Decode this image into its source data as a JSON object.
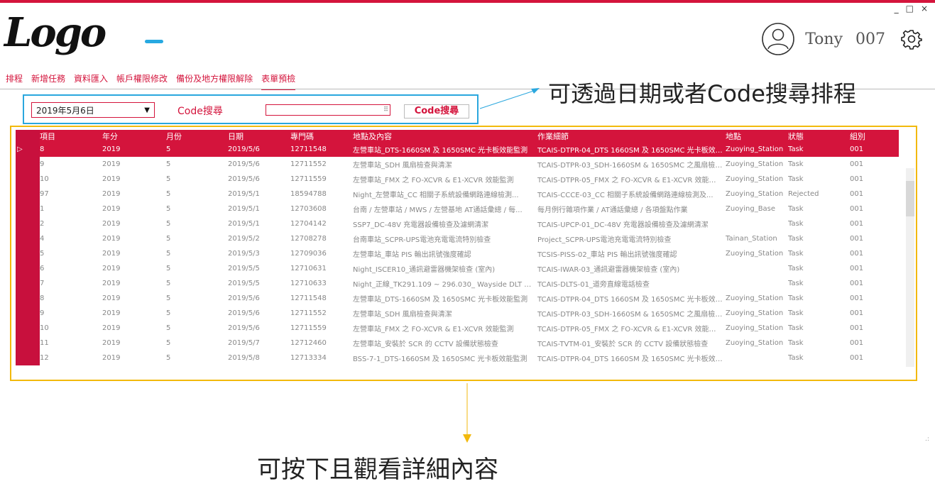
{
  "window": {
    "minimize": "_",
    "maximize": "□",
    "close": "×"
  },
  "brand": {
    "logo_text": "Logo"
  },
  "user": {
    "name": "Tony",
    "id": "007"
  },
  "nav": {
    "items": [
      "排程",
      "新增任務",
      "資料匯入",
      "帳戶權限修改",
      "備份及地方權限解除",
      "表單預檢"
    ],
    "active_index": 5
  },
  "search": {
    "date_value": "2019年5月6日",
    "code_label": "Code搜尋",
    "code_value": "",
    "input_icon": "⠿",
    "button_label": "Code搜尋"
  },
  "annotations": {
    "search_hint": "可透過日期或者Code搜尋排程",
    "detail_hint": "可按下且觀看詳細內容"
  },
  "table": {
    "columns": [
      "項目",
      "年分",
      "月份",
      "日期",
      "專門碼",
      "地點及內容",
      "作業細節",
      "地點",
      "狀態",
      "組別"
    ],
    "selected_marker": "▷",
    "selected_index": 0,
    "rows": [
      [
        "8",
        "2019",
        "5",
        "2019/5/6",
        "12711548",
        "左營車站_DTS-1660SM 及 1650SMC 光卡板效能監測",
        "TCAIS-DTPR-04_DTS 1660SM 及 1650SMC 光卡板效能...",
        "Zuoying_Station",
        "Task",
        "001"
      ],
      [
        "9",
        "2019",
        "5",
        "2019/5/6",
        "12711552",
        "左營車站_SDH 風扇檢查與清潔",
        "TCAIS-DTPR-03_SDH-1660SM & 1650SMC 之風扇檢查...",
        "Zuoying_Station",
        "Task",
        "001"
      ],
      [
        "10",
        "2019",
        "5",
        "2019/5/6",
        "12711559",
        "左營車站_FMX 之 FO-XCVR & E1-XCVR 效能監測",
        "TCAIS-DTPR-05_FMX 之 FO-XCVR & E1-XCVR 效能監測",
        "Zuoying_Station",
        "Task",
        "001"
      ],
      [
        "97",
        "2019",
        "5",
        "2019/5/1",
        "18594788",
        "Night_左營車站_CC 相關子系統設備網路連線檢測...",
        "TCAIS-CCCE-03_CC 相關子系統設備網路連線檢測及...",
        "Zuoying_Station",
        "Rejected",
        "001"
      ],
      [
        "1",
        "2019",
        "5",
        "2019/5/1",
        "12703608",
        "台南 / 左營車站 / MWS / 左營基地 AT通話彙總 / 每...",
        "每月例行雜項作業 / AT通話彙總 / 各項盤點作業",
        "Zuoying_Base",
        "Task",
        "001"
      ],
      [
        "2",
        "2019",
        "5",
        "2019/5/1",
        "12704142",
        "SSP7_DC-48V 充電器設備檢查及濾網清潔",
        "TCAIS-UPCP-01_DC-48V 充電器設備檢查及濾網清潔",
        "",
        "Task",
        "001"
      ],
      [
        "4",
        "2019",
        "5",
        "2019/5/2",
        "12708278",
        "台南車站_SCPR-UPS電池充電電流特別檢查",
        "Project_SCPR-UPS電池充電電流特別檢查",
        "Tainan_Station",
        "Task",
        "001"
      ],
      [
        "5",
        "2019",
        "5",
        "2019/5/3",
        "12709036",
        "左營車站_車站 PIS 輸出訊號強度確認",
        "TCSIS-PISS-02_車站 PIS 輸出訊號強度確認",
        "Zuoying_Station",
        "Task",
        "001"
      ],
      [
        "6",
        "2019",
        "5",
        "2019/5/5",
        "12710631",
        "Night_ISCER10_通訊避雷器機架檢查 (室內)",
        "TCAIS-IWAR-03_通訊避雷器機架檢查 (室內)",
        "",
        "Task",
        "001"
      ],
      [
        "7",
        "2019",
        "5",
        "2019/5/5",
        "12710633",
        "Night_正線_TK291.109 ~ 296.030_ Wayside DLT 功能及...",
        "TCAIS-DLTS-01_道旁直線電話檢查",
        "",
        "Task",
        "001"
      ],
      [
        "8",
        "2019",
        "5",
        "2019/5/6",
        "12711548",
        "左營車站_DTS-1660SM 及 1650SMC 光卡板效能監測",
        "TCAIS-DTPR-04_DTS 1660SM 及 1650SMC 光卡板效能...",
        "Zuoying_Station",
        "Task",
        "001"
      ],
      [
        "9",
        "2019",
        "5",
        "2019/5/6",
        "12711552",
        "左營車站_SDH 風扇檢查與清潔",
        "TCAIS-DTPR-03_SDH-1660SM & 1650SMC 之風扇檢查...",
        "Zuoying_Station",
        "Task",
        "001"
      ],
      [
        "10",
        "2019",
        "5",
        "2019/5/6",
        "12711559",
        "左營車站_FMX 之 FO-XCVR & E1-XCVR 效能監測",
        "TCAIS-DTPR-05_FMX 之 FO-XCVR & E1-XCVR 效能監測",
        "Zuoying_Station",
        "Task",
        "001"
      ],
      [
        "11",
        "2019",
        "5",
        "2019/5/7",
        "12712460",
        "左營車站_安裝於 SCR 的 CCTV 設備狀態檢查",
        "TCAIS-TVTM-01_安裝於 SCR 的 CCTV 設備狀態檢查",
        "Zuoying_Station",
        "Task",
        "001"
      ],
      [
        "12",
        "2019",
        "5",
        "2019/5/8",
        "12713334",
        "BSS-7-1_DTS-1660SM 及 1650SMC 光卡板效能監測",
        "TCAIS-DTPR-04_DTS 1660SM 及 1650SMC 光卡板效能...",
        "",
        "Task",
        "001"
      ]
    ]
  },
  "colors": {
    "accent": "#d4143c",
    "search_frame": "#2aa7de",
    "table_frame": "#f2b90c"
  },
  "icons": {
    "avatar": "user-avatar-icon",
    "settings": "gear-icon",
    "dropdown": "triangle-down-icon"
  }
}
